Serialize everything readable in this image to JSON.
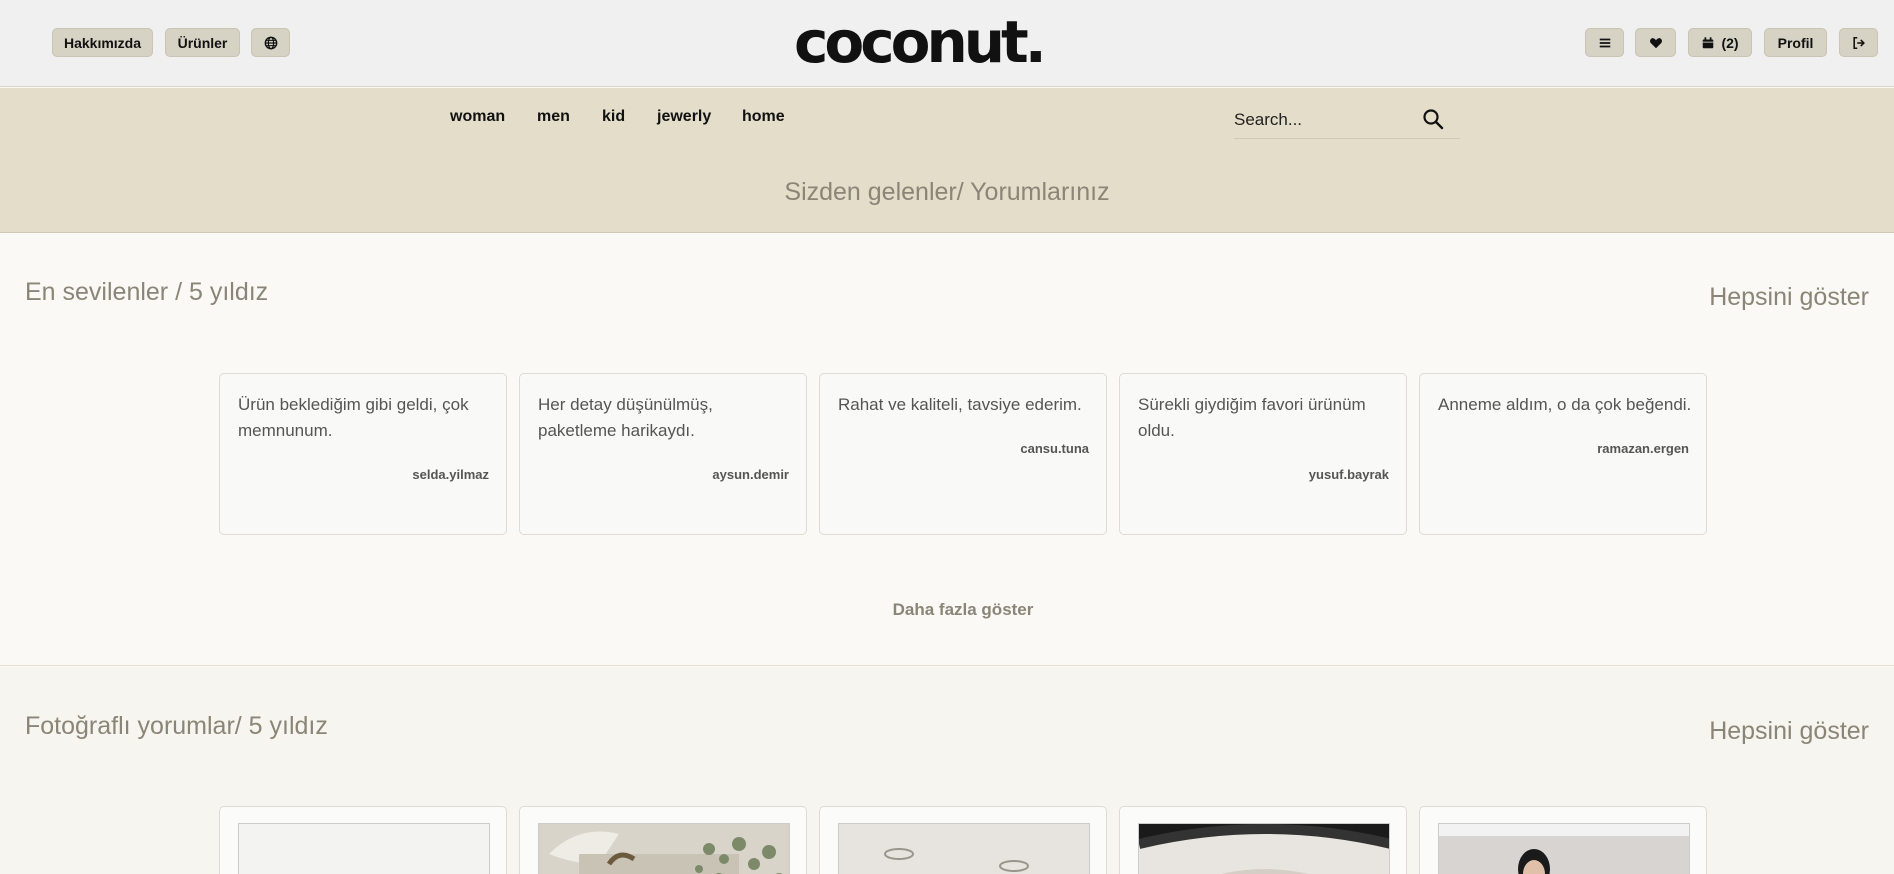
{
  "header": {
    "about_label": "Hakkımızda",
    "products_label": "Ürünler",
    "logo_text": "coconut.",
    "cart_count": "(2)",
    "profile_label": "Profil"
  },
  "nav": {
    "links": [
      "woman",
      "men",
      "kid",
      "jewerly",
      "home"
    ],
    "search_placeholder": "Search..."
  },
  "banner_title": "Sizden gelenler/ Yorumlarınız",
  "top_reviews": {
    "title": "En sevilenler / 5 yıldız",
    "show_all": "Hepsini göster",
    "cards": [
      {
        "text": "Ürün beklediğim gibi geldi, çok memnunum.",
        "user": "selda.yilmaz"
      },
      {
        "text": "Her detay düşünülmüş, paketleme harikaydı.",
        "user": "aysun.demir"
      },
      {
        "text": "Rahat ve kaliteli, tavsiye ederim.",
        "user": "cansu.tuna"
      },
      {
        "text": "Sürekli giydiğim favori ürünüm oldu.",
        "user": "yusuf.bayrak"
      },
      {
        "text": "Anneme aldım, o da çok beğendi.",
        "user": "ramazan.ergen"
      }
    ],
    "more_label": "Daha fazla göster"
  },
  "photo_reviews": {
    "title": "Fotoğraflı yorumlar/ 5 yıldız",
    "show_all": "Hepsini göster"
  },
  "colors": {
    "topbar_bg": "#f1f0f0",
    "nav_band_bg": "#e3ddc9",
    "pill_bg": "#d6d2c4",
    "muted_text": "#8a8577"
  }
}
